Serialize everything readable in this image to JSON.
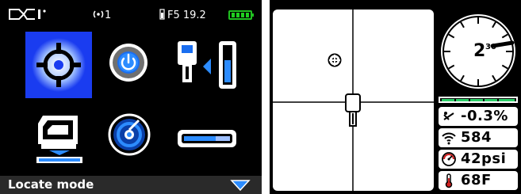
{
  "left_screen": {
    "status": {
      "brand": "DCI",
      "signal_count": "1",
      "frequency": "F5 19.2",
      "battery_level": 1.0
    },
    "menu_icons": [
      {
        "name": "locate-icon",
        "selected": true
      },
      {
        "name": "power-icon"
      },
      {
        "name": "transmitter-icon"
      },
      {
        "name": "settings-icon"
      },
      {
        "name": "target-icon"
      },
      {
        "name": "slider-icon"
      }
    ],
    "bottom_bar": {
      "label": "Locate mode"
    }
  },
  "right_screen": {
    "clock": {
      "hour": "2",
      "minutes": "30"
    },
    "stats": {
      "pitch": "-0.3%",
      "signal": "584",
      "pressure": "42psi",
      "temperature": "68F"
    }
  },
  "colors": {
    "selection_blue": "#1a3cf0",
    "accent_green": "#2fd06a",
    "background": "#000000"
  }
}
